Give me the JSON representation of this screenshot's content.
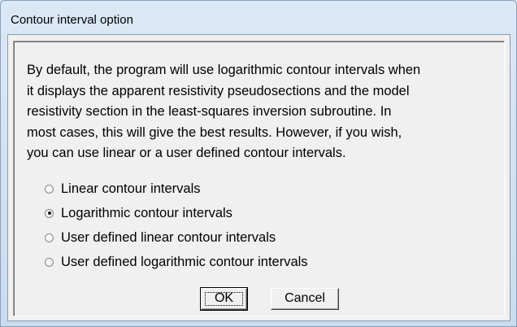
{
  "window": {
    "title": "Contour interval option"
  },
  "description": {
    "lines": [
      "By default, the program will use logarithmic contour intervals when",
      "it displays the apparent resistivity pseudosections and the model",
      "resistivity section in the least-squares inversion subroutine. In",
      "most cases, this will give the best results. However, if you wish,",
      "you can use linear or a user defined contour intervals."
    ]
  },
  "options": [
    {
      "label": "Linear contour intervals",
      "checked": false
    },
    {
      "label": "Logarithmic contour intervals",
      "checked": true
    },
    {
      "label": "User defined linear contour intervals",
      "checked": false
    },
    {
      "label": "User defined logarithmic contour intervals",
      "checked": false
    }
  ],
  "buttons": {
    "ok_label": "OK",
    "cancel_label": "Cancel"
  }
}
